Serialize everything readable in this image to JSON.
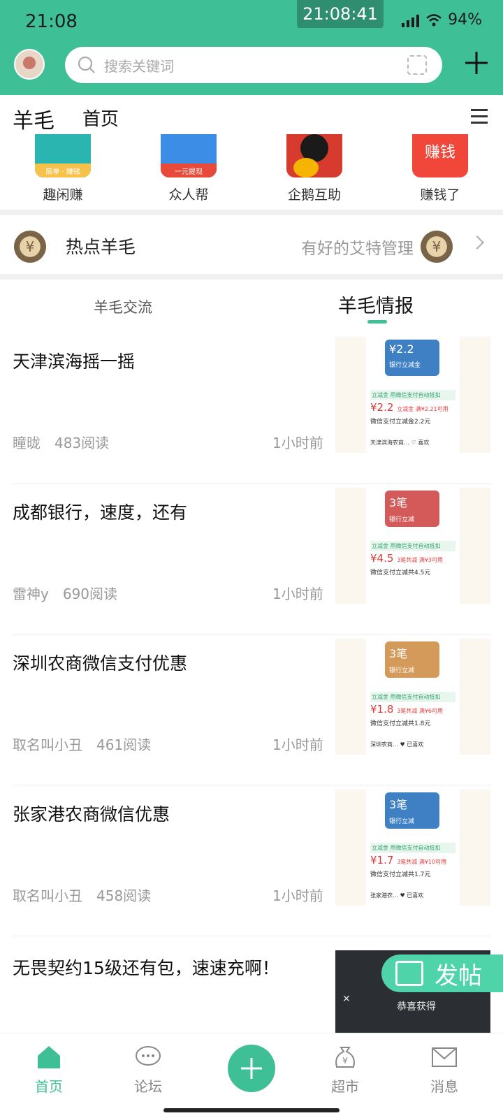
{
  "status_bar": {
    "time": "21:08",
    "clock_overlay": "21:08:41",
    "battery": "94%"
  },
  "search": {
    "placeholder": "搜索关键词"
  },
  "section_tabs": {
    "primary": "羊毛",
    "secondary": "首页"
  },
  "apps": [
    {
      "label": "趣闲赚",
      "sub": "简单 · 赚钱",
      "color": "#f6c24b"
    },
    {
      "label": "众人帮",
      "sub": "一元提现",
      "color": "#3c8de6"
    },
    {
      "label": "企鹅互助",
      "sub": "",
      "color": "#d63b2e"
    },
    {
      "label": "赚钱了",
      "sub": "赚钱",
      "color": "#f0473a"
    }
  ],
  "hot": {
    "title": "热点羊毛",
    "admin": "有好的艾特管理"
  },
  "subtabs": {
    "left": "羊毛交流",
    "right": "羊毛情报"
  },
  "posts": [
    {
      "title": "天津滨海摇一摇",
      "author": "瞳昽",
      "reads": "483阅读",
      "ago": "1小时前",
      "thumb": {
        "coupon": "¥2.2",
        "coupon_sub": "银行立减金",
        "coupon_color": "#3f7fc4",
        "tag": "立减金 用微信支付自动抵扣",
        "amount": "¥2.2",
        "amount_note": "立减金 满¥2.21可用",
        "desc": "微信支付立减金2.2元",
        "foot": "天津滨海农商… ♡ 喜欢"
      }
    },
    {
      "title": "成都银行，速度，还有",
      "author": "雷神y",
      "reads": "690阅读",
      "ago": "1小时前",
      "thumb": {
        "coupon": "3笔",
        "coupon_sub": "银行立减",
        "coupon_color": "#d45a5a",
        "tag": "立减金 用微信支付自动抵扣",
        "amount": "¥4.5",
        "amount_note": "3笔共减 满¥3可用",
        "desc": "微信支付立减共4.5元",
        "foot": ""
      }
    },
    {
      "title": "深圳农商微信支付优惠",
      "author": "取名叫小丑",
      "reads": "461阅读",
      "ago": "1小时前",
      "thumb": {
        "coupon": "3笔",
        "coupon_sub": "银行立减",
        "coupon_color": "#d49a5a",
        "tag": "立减金 用微信支付自动抵扣",
        "amount": "¥1.8",
        "amount_note": "3笔共减 满¥6可用",
        "desc": "微信支付立减共1.8元",
        "foot": "深圳农商… ♥ 已喜欢"
      }
    },
    {
      "title": "张家港农商微信优惠",
      "author": "取名叫小丑",
      "reads": "458阅读",
      "ago": "1小时前",
      "thumb": {
        "coupon": "3笔",
        "coupon_sub": "银行立减",
        "coupon_color": "#3f7fc4",
        "tag": "立减金 用微信支付自动抵扣",
        "amount": "¥1.7",
        "amount_note": "3笔共减 满¥10可用",
        "desc": "微信支付立减共1.7元",
        "foot": "张家港农… ♥ 已喜欢"
      }
    }
  ],
  "partial_post": {
    "title": "无畏契约15级还有包，速速充啊！",
    "overlay": "恭喜获得"
  },
  "fab": {
    "label": "发帖"
  },
  "tabbar": [
    {
      "label": "首页"
    },
    {
      "label": "论坛"
    },
    {
      "label": "超市"
    },
    {
      "label": "消息"
    }
  ]
}
